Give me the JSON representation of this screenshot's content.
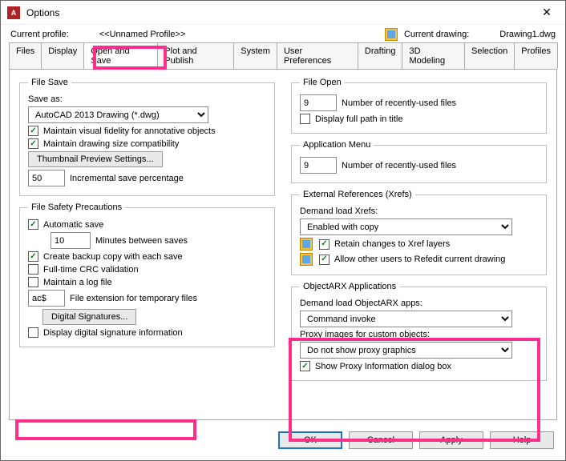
{
  "window": {
    "title": "Options"
  },
  "header": {
    "profile_label": "Current profile:",
    "profile_value": "<<Unnamed Profile>>",
    "drawing_label": "Current drawing:",
    "drawing_value": "Drawing1.dwg"
  },
  "tabs": {
    "files": "Files",
    "display": "Display",
    "open_save": "Open and Save",
    "plot": "Plot and Publish",
    "system": "System",
    "user_prefs": "User Preferences",
    "drafting": "Drafting",
    "modeling": "3D Modeling",
    "selection": "Selection",
    "profiles": "Profiles"
  },
  "file_save": {
    "legend": "File Save",
    "save_as_label": "Save as:",
    "save_as_value": "AutoCAD 2013 Drawing (*.dwg)",
    "annotative": "Maintain visual fidelity for annotative objects",
    "compat": "Maintain drawing size compatibility",
    "thumb_btn": "Thumbnail Preview Settings...",
    "incr_value": "50",
    "incr_label": "Incremental save percentage"
  },
  "safety": {
    "legend": "File Safety Precautions",
    "autosave": "Automatic save",
    "minutes_value": "10",
    "minutes_label": "Minutes between saves",
    "backup": "Create backup copy with each save",
    "crc": "Full-time CRC validation",
    "logfile": "Maintain a log file",
    "ext_value": "ac$",
    "ext_label": "File extension for temporary files",
    "sig_btn": "Digital Signatures...",
    "display_sig": "Display digital signature information"
  },
  "file_open": {
    "legend": "File Open",
    "recent_value": "9",
    "recent_label": "Number of recently-used files",
    "fullpath": "Display full path in title"
  },
  "app_menu": {
    "legend": "Application Menu",
    "recent_value": "9",
    "recent_label": "Number of recently-used files"
  },
  "xrefs": {
    "legend": "External References (Xrefs)",
    "demand_label": "Demand load Xrefs:",
    "demand_value": "Enabled with copy",
    "retain": "Retain changes to Xref layers",
    "refedit": "Allow other users to Refedit current drawing"
  },
  "arx": {
    "legend": "ObjectARX Applications",
    "demand_label": "Demand load ObjectARX apps:",
    "demand_value": "Command invoke",
    "proxy_label": "Proxy images for custom objects:",
    "proxy_value": "Do not show proxy graphics",
    "show_proxy": "Show Proxy Information dialog box"
  },
  "buttons": {
    "ok": "OK",
    "cancel": "Cancel",
    "apply": "Apply",
    "help": "Help"
  }
}
